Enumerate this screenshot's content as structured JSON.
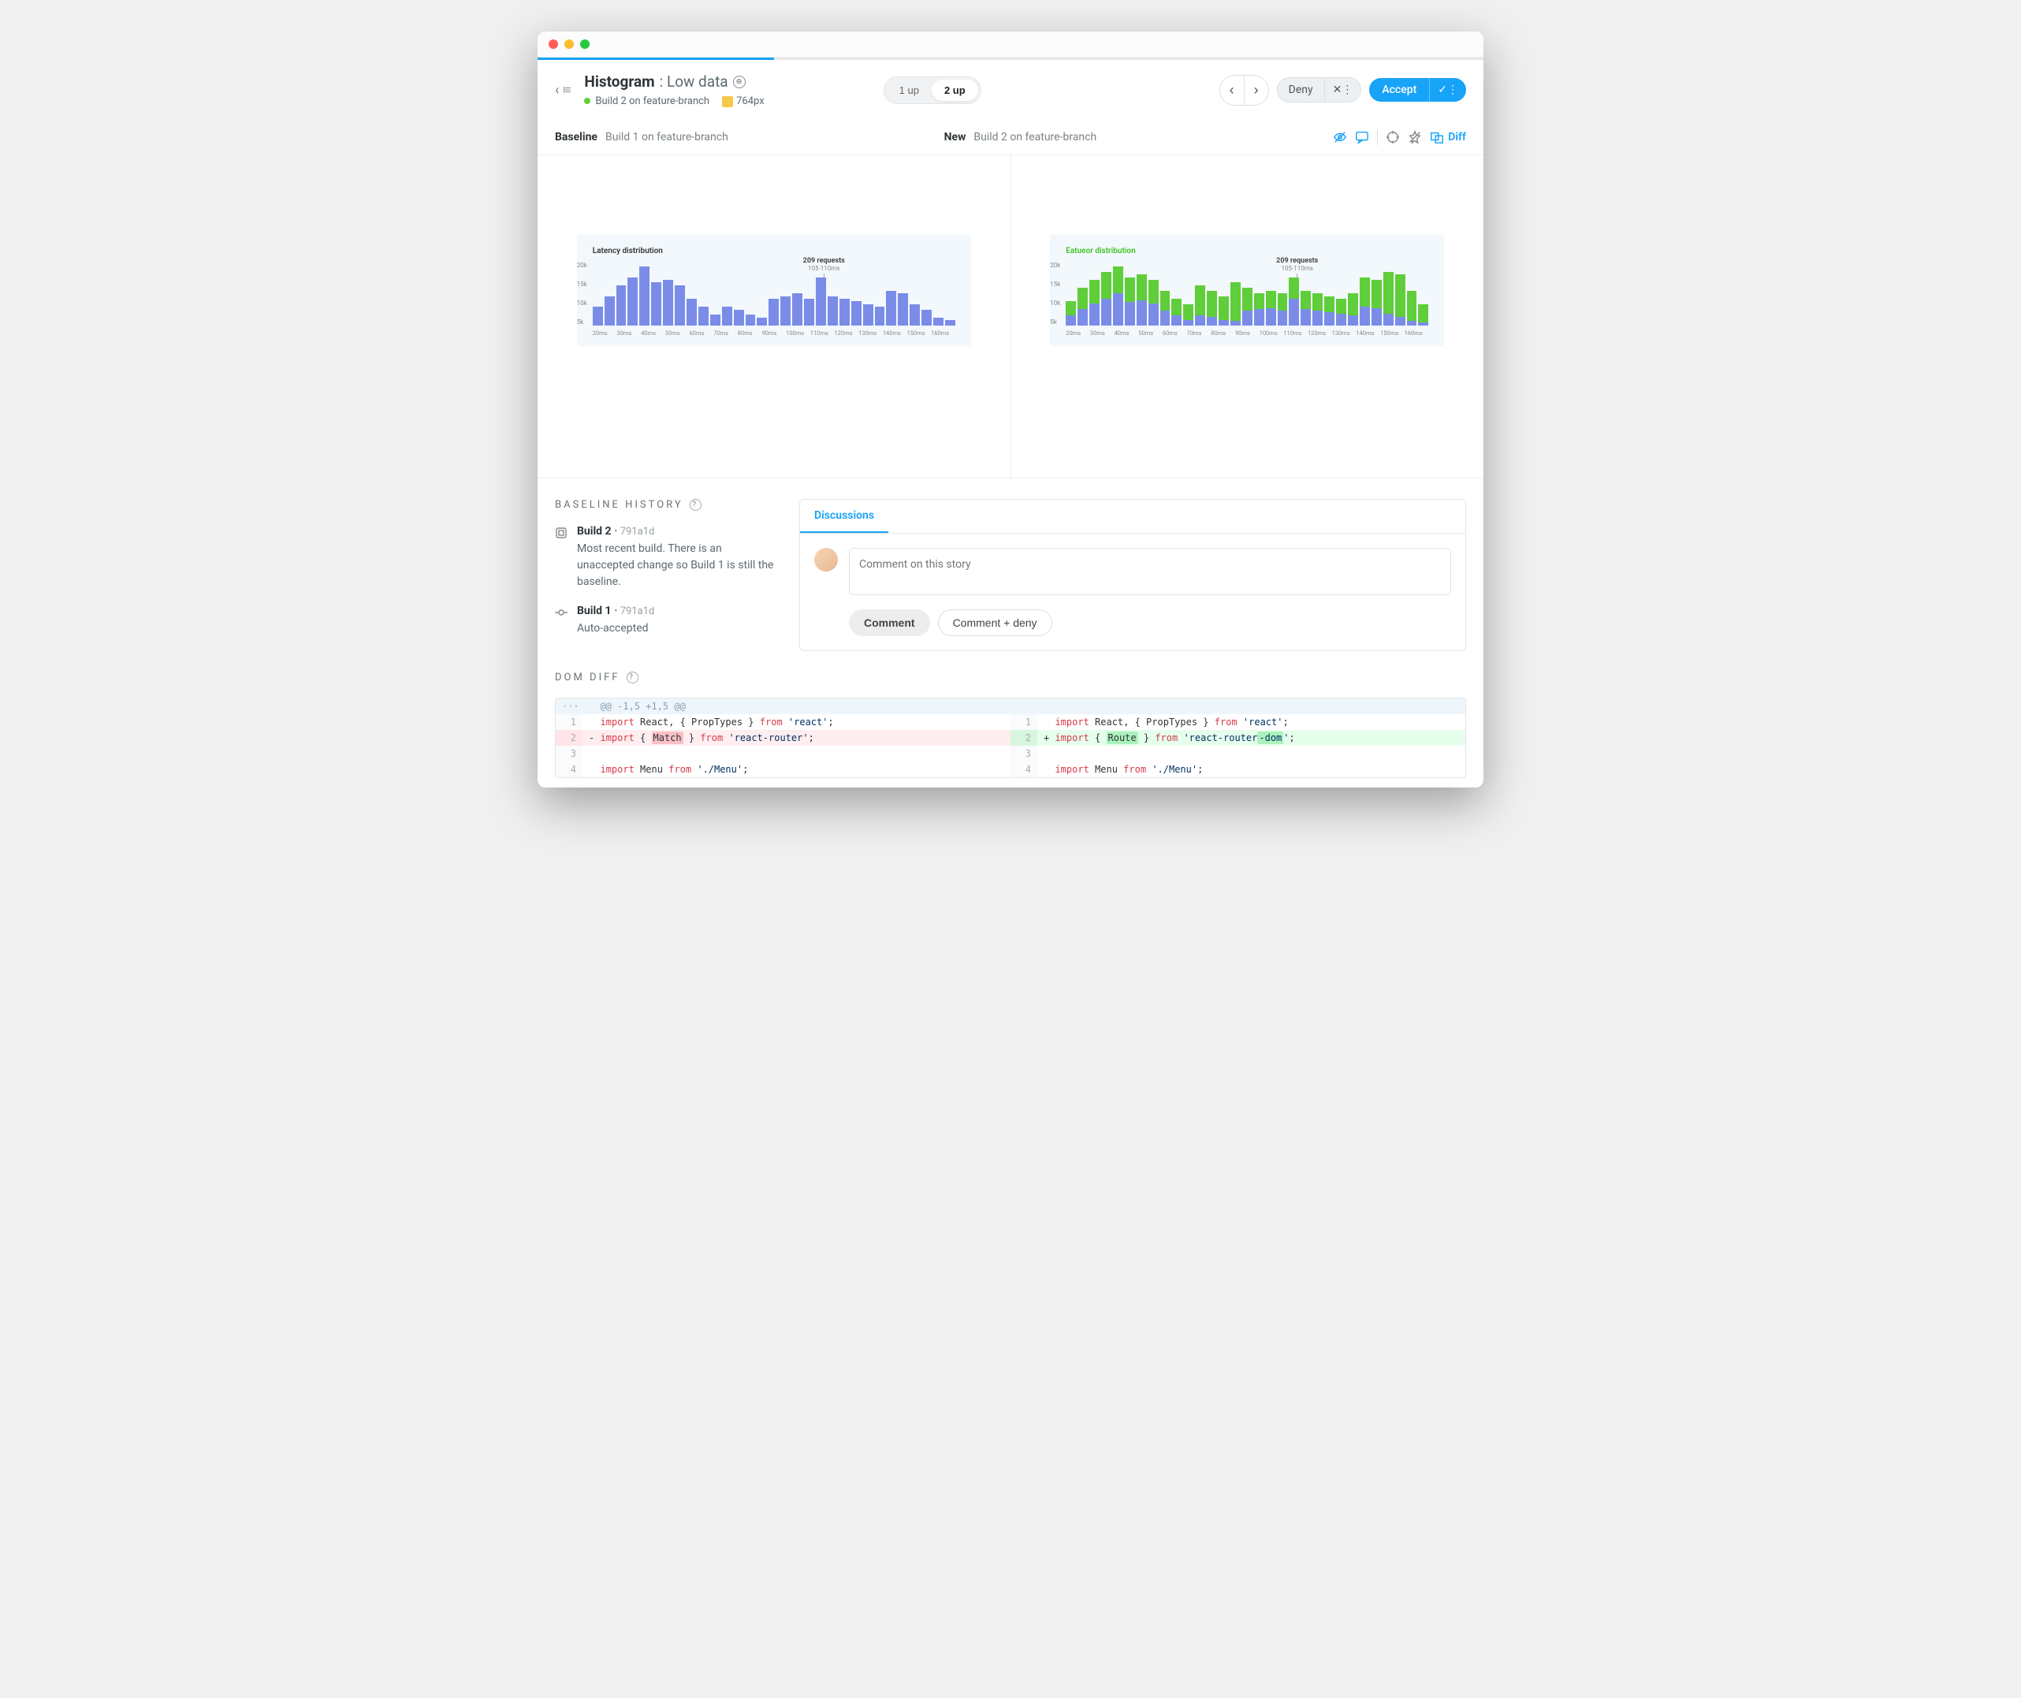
{
  "header": {
    "title": "Histogram",
    "subtitle": "Low data",
    "build_label": "Build 2 on feature-branch",
    "viewport": "764px"
  },
  "toggle": {
    "opt1": "1 up",
    "opt2": "2 up"
  },
  "actions": {
    "deny": "Deny",
    "accept": "Accept"
  },
  "compare": {
    "baseline_label": "Baseline",
    "baseline_build": "Build 1 on feature-branch",
    "new_label": "New",
    "new_build": "Build 2 on feature-branch",
    "diff_label": "Diff"
  },
  "chart": {
    "title_baseline": "Latency distribution",
    "title_new": "Eatueor distribution",
    "tooltip_value": "209 requests",
    "tooltip_range": "105-110ms"
  },
  "chart_data": {
    "type": "bar",
    "title": "Latency distribution",
    "xlabel": "ms",
    "ylabel": "requests",
    "ylim": [
      0,
      22000
    ],
    "yticks": [
      "20k",
      "15k",
      "10k",
      "5k"
    ],
    "categories": [
      "20ms",
      "25ms",
      "30ms",
      "35ms",
      "40ms",
      "45ms",
      "50ms",
      "55ms",
      "60ms",
      "65ms",
      "70ms",
      "75ms",
      "80ms",
      "85ms",
      "90ms",
      "95ms",
      "100ms",
      "105ms",
      "110ms",
      "115ms",
      "120ms",
      "125ms",
      "130ms",
      "135ms",
      "140ms",
      "145ms",
      "150ms",
      "155ms",
      "160ms"
    ],
    "xticks": [
      "20ms",
      "30ms",
      "40ms",
      "50ms",
      "60ms",
      "70ms",
      "80ms",
      "90ms",
      "100ms",
      "110ms",
      "120ms",
      "130ms",
      "140ms",
      "150ms",
      "160ms"
    ],
    "series": [
      {
        "name": "baseline",
        "color": "#7b8ce8",
        "values": [
          7000,
          11000,
          15000,
          18000,
          22000,
          16000,
          17000,
          15000,
          10000,
          7000,
          4000,
          7000,
          6000,
          4000,
          3000,
          10000,
          11000,
          12000,
          10000,
          18000,
          11000,
          10000,
          9000,
          8000,
          7000,
          13000,
          12000,
          8000,
          6000,
          3000,
          2000
        ]
      },
      {
        "name": "new_overlay",
        "color": "#5fce3a",
        "values": [
          9000,
          14000,
          17000,
          20000,
          22000,
          18000,
          19000,
          17000,
          13000,
          10000,
          8000,
          15000,
          13000,
          11000,
          16000,
          14000,
          12000,
          13000,
          12000,
          18000,
          13000,
          12000,
          11000,
          10000,
          12000,
          18000,
          17000,
          20000,
          19000,
          13000,
          8000
        ]
      }
    ],
    "annotation": {
      "x": "105-110ms",
      "label": "209 requests"
    }
  },
  "history": {
    "title": "BASELINE HISTORY",
    "builds": [
      {
        "name": "Build 2",
        "hash": "791a1d",
        "desc": "Most recent build. There is an unaccepted change so Build 1 is still the baseline."
      },
      {
        "name": "Build 1",
        "hash": "791a1d",
        "desc": "Auto-accepted"
      }
    ]
  },
  "discussion": {
    "tab": "Discussions",
    "placeholder": "Comment on this story",
    "comment_btn": "Comment",
    "comment_deny_btn": "Comment + deny"
  },
  "domdiff": {
    "title": "DOM DIFF",
    "hunk": "@@ -1,5 +1,5 @@",
    "left": [
      "import React, { PropTypes } from 'react';",
      "import { Match } from 'react-router';",
      "",
      "import Menu from './Menu';"
    ],
    "right": [
      "import React, { PropTypes } from 'react';",
      "import { Route } from 'react-router-dom';",
      "",
      "import Menu from './Menu';"
    ]
  }
}
